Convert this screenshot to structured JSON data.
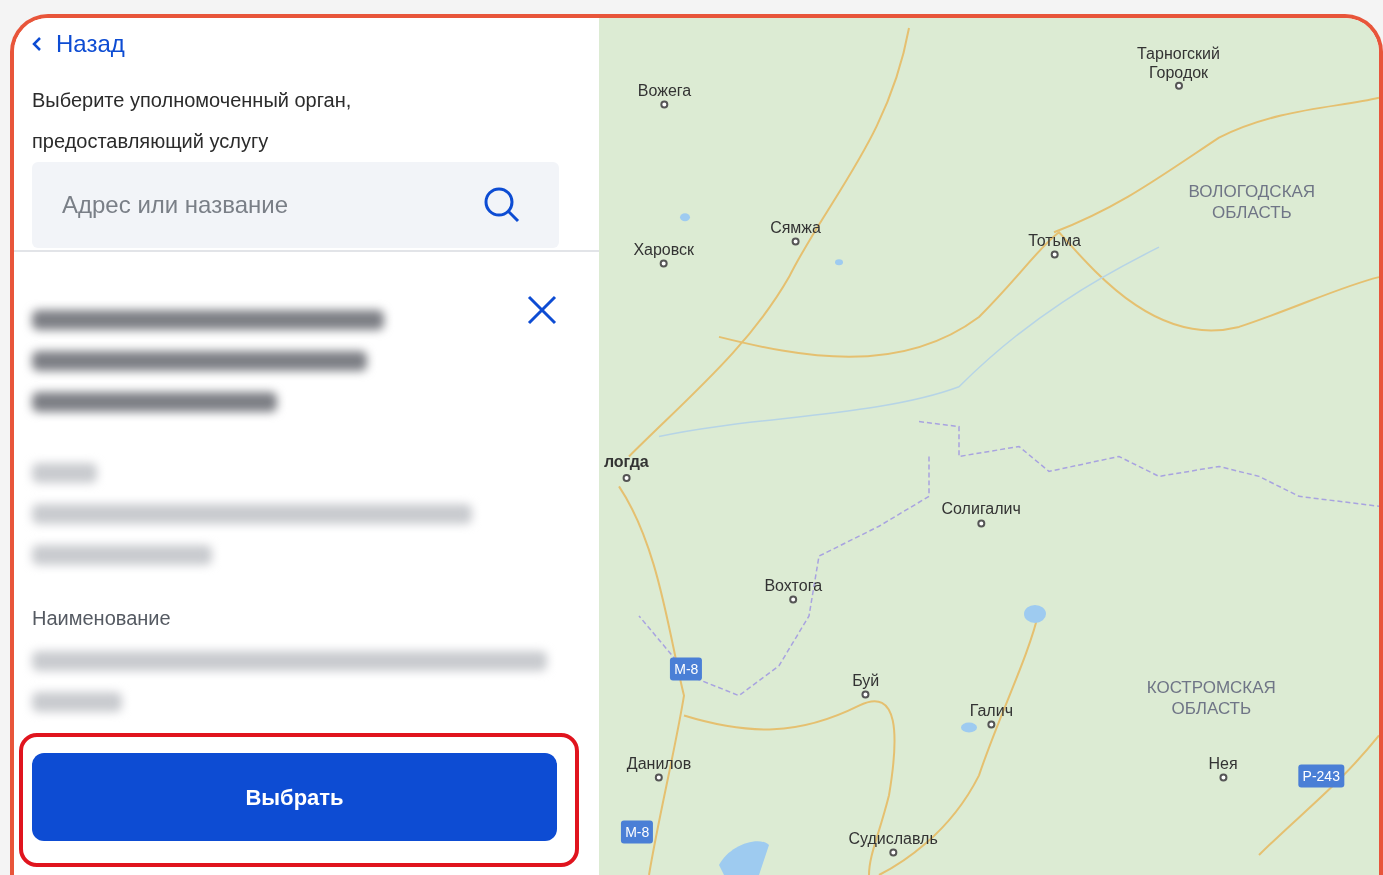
{
  "back_link": "Назад",
  "prompt": "Выберите уполномоченный орган, предоставляющий услугу",
  "search": {
    "placeholder": "Адрес или название"
  },
  "result": {
    "field_label": "Наименование"
  },
  "select_button": "Выбрать",
  "map": {
    "labels": [
      {
        "kind": "city",
        "text": "Тарногский Городок"
      },
      {
        "kind": "city",
        "text": "Вожега"
      },
      {
        "kind": "region",
        "text": "ВОЛОГОДСКАЯ ОБЛАСТЬ"
      },
      {
        "kind": "city",
        "text": "Сямжа"
      },
      {
        "kind": "city",
        "text": "Тотьма"
      },
      {
        "kind": "city",
        "text": "Харовск"
      },
      {
        "kind": "capital",
        "text": "логда"
      },
      {
        "kind": "city",
        "text": "Солигалич"
      },
      {
        "kind": "city",
        "text": "Вохтога"
      },
      {
        "kind": "road",
        "text": "М-8"
      },
      {
        "kind": "city",
        "text": "Буй"
      },
      {
        "kind": "city",
        "text": "Галич"
      },
      {
        "kind": "region",
        "text": "КОСТРОМСКАЯ ОБЛАСТЬ"
      },
      {
        "kind": "city",
        "text": "Данилов"
      },
      {
        "kind": "city",
        "text": "Нея"
      },
      {
        "kind": "road",
        "text": "Р-243"
      },
      {
        "kind": "road",
        "text": "М-8"
      },
      {
        "kind": "city",
        "text": "Судиславль"
      }
    ]
  }
}
